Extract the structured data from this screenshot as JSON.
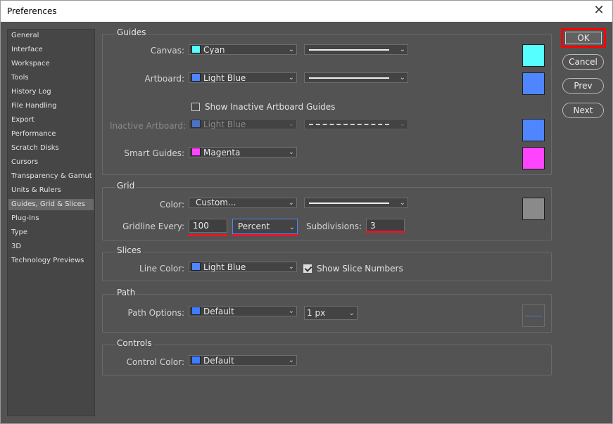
{
  "window": {
    "title": "Preferences",
    "close_glyph": "✕"
  },
  "sidebar": {
    "items": [
      "General",
      "Interface",
      "Workspace",
      "Tools",
      "History Log",
      "File Handling",
      "Export",
      "Performance",
      "Scratch Disks",
      "Cursors",
      "Transparency & Gamut",
      "Units & Rulers",
      "Guides, Grid & Slices",
      "Plug-Ins",
      "Type",
      "3D",
      "Technology Previews"
    ],
    "selected": "Guides, Grid & Slices"
  },
  "guides": {
    "legend": "Guides",
    "canvas_label": "Canvas:",
    "canvas_color": "Cyan",
    "canvas_hex": "#55ffff",
    "artboard_label": "Artboard:",
    "artboard_color": "Light Blue",
    "artboard_hex": "#4f86ff",
    "show_inactive_label": "Show Inactive Artboard Guides",
    "show_inactive_checked": false,
    "inactive_label": "Inactive Artboard:",
    "inactive_color": "Light Blue",
    "inactive_hex": "#4f86ff",
    "smart_label": "Smart Guides:",
    "smart_color": "Magenta",
    "smart_hex": "#ff44ff"
  },
  "grid": {
    "legend": "Grid",
    "color_label": "Color:",
    "color_value": "Custom...",
    "color_hex": "#8a8a8a",
    "gridline_label": "Gridline Every:",
    "gridline_value": "100",
    "gridline_unit": "Percent",
    "subdivisions_label": "Subdivisions:",
    "subdivisions_value": "3"
  },
  "slices": {
    "legend": "Slices",
    "line_color_label": "Line Color:",
    "line_color": "Light Blue",
    "line_color_hex": "#4f86ff",
    "show_numbers_label": "Show Slice Numbers",
    "show_numbers_checked": true
  },
  "path": {
    "legend": "Path",
    "options_label": "Path Options:",
    "options_color": "Default",
    "options_hex": "#3d7cff",
    "width": "1 px"
  },
  "controls": {
    "legend": "Controls",
    "color_label": "Control Color:",
    "color_value": "Default",
    "color_hex": "#3d7cff"
  },
  "buttons": {
    "ok": "OK",
    "cancel": "Cancel",
    "prev": "Prev",
    "next": "Next"
  },
  "annotation_color": "#ff0000"
}
